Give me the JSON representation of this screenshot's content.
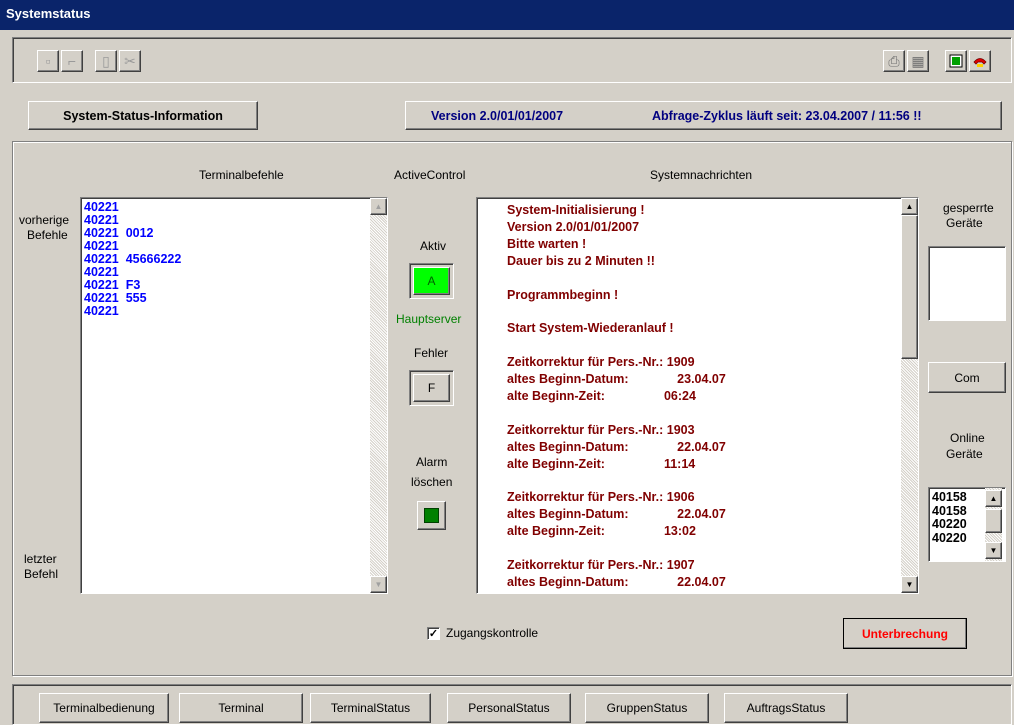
{
  "window": {
    "title": "Systemstatus"
  },
  "header": {
    "info_label": "System-Status-Information",
    "version": "Version 2.0/01/01/2007",
    "cycle": "Abfrage-Zyklus läuft seit: 23.04.2007 / 11:56 !!"
  },
  "terminal": {
    "title": "Terminalbefehle",
    "prev_label_1": "vorherige",
    "prev_label_2": "Befehle",
    "last_label_1": "letzter",
    "last_label_2": "Befehl",
    "lines": [
      "40221",
      "40221",
      "40221  0012",
      "40221",
      "40221  45666222",
      "40221",
      "40221  F3",
      "40221  555",
      "40221"
    ]
  },
  "active_control": {
    "title": "ActiveControl",
    "aktiv_label": "Aktiv",
    "aktiv_button": "A",
    "server_label": "Hauptserver",
    "fehler_label": "Fehler",
    "fehler_button": "F",
    "alarm_label_1": "Alarm",
    "alarm_label_2": "löschen"
  },
  "messages": {
    "title": "Systemnachrichten",
    "lines": [
      "System-Initialisierung !",
      "Version 2.0/01/01/2007",
      "Bitte warten !",
      "Dauer bis zu 2 Minuten !!",
      "",
      "Programmbeginn !",
      "",
      "Start System-Wiederanlauf !",
      "",
      "Zeitkorrektur für Pers.-Nr.: 1909",
      "altes Beginn-Datum:              23.04.07",
      "alte Beginn-Zeit:                 06:24",
      "",
      "Zeitkorrektur für Pers.-Nr.: 1903",
      "altes Beginn-Datum:              22.04.07",
      "alte Beginn-Zeit:                 11:14",
      "",
      "Zeitkorrektur für Pers.-Nr.: 1906",
      "altes Beginn-Datum:              22.04.07",
      "alte Beginn-Zeit:                 13:02",
      "",
      "Zeitkorrektur für Pers.-Nr.: 1907",
      "altes Beginn-Datum:              22.04.07"
    ]
  },
  "right": {
    "locked_label_1": "gesperrte",
    "locked_label_2": "Geräte",
    "com_button": "Com",
    "online_label_1": "Online",
    "online_label_2": "Geräte",
    "online_list": [
      "40158",
      "40158",
      "40220",
      "40220"
    ]
  },
  "bottom": {
    "checkbox_label": "Zugangskontrolle",
    "checkbox_checked": true,
    "interrupt_button": "Unterbrechung"
  },
  "tabs": [
    "Terminalbedienung",
    "Terminal",
    "TerminalStatus",
    "PersonalStatus",
    "GruppenStatus",
    "AuftragsStatus"
  ],
  "colors": {
    "terminal_text": "#0000ff",
    "message_text": "#800000",
    "interrupt_text": "#ff0000",
    "server_text": "#008000",
    "aktiv_indicator": "#00ff00"
  }
}
